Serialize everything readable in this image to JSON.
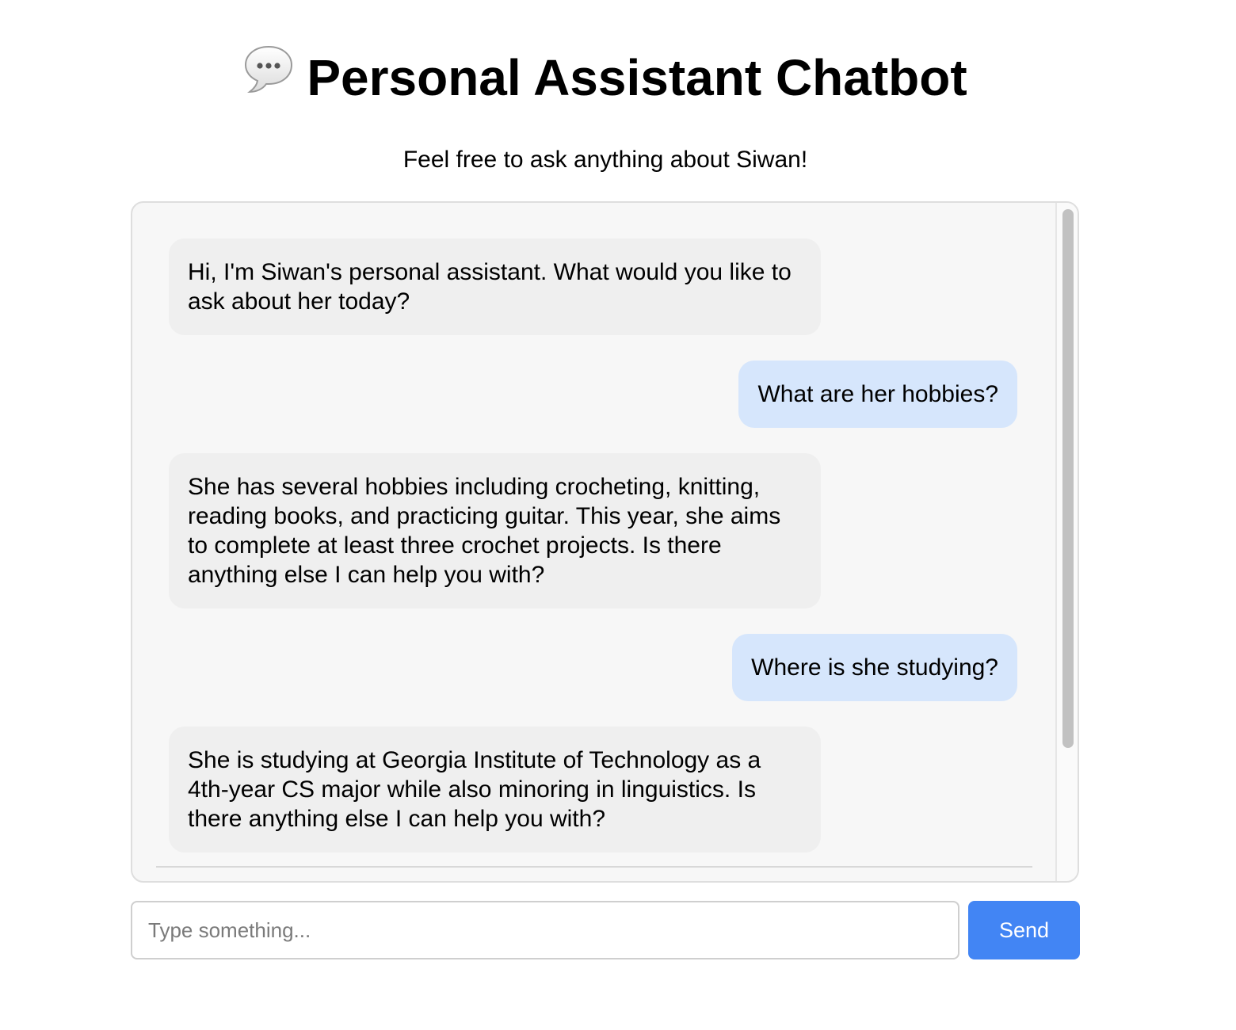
{
  "header": {
    "icon": "speech-bubble-icon",
    "title": "Personal Assistant Chatbot",
    "subtitle": "Feel free to ask anything about Siwan!"
  },
  "chat": {
    "messages": [
      {
        "role": "bot",
        "text": "Hi, I'm Siwan's personal assistant. What would you like to ask about her today?"
      },
      {
        "role": "user",
        "text": "What are her hobbies?"
      },
      {
        "role": "bot",
        "text": "She has several hobbies including crocheting, knitting, reading books, and practicing guitar. This year, she aims to complete at least three crochet projects. Is there anything else I can help you with?"
      },
      {
        "role": "user",
        "text": "Where is she studying?"
      },
      {
        "role": "bot",
        "text": "She is studying at Georgia Institute of Technology as a 4th-year CS major while also minoring in linguistics. Is there anything else I can help you with?"
      }
    ]
  },
  "composer": {
    "placeholder": "Type something...",
    "value": "",
    "send_label": "Send"
  },
  "colors": {
    "bot_bubble": "#efefef",
    "user_bubble": "#d6e6fc",
    "send_button": "#4285f4",
    "chat_background": "#f7f7f7"
  }
}
